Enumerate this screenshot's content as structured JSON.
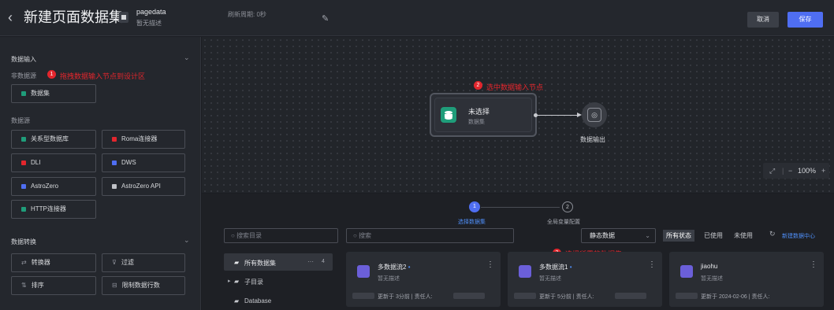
{
  "header": {
    "title": "新建页面数据集",
    "dataset_name": "pagedata",
    "dataset_desc": "暂无描述",
    "refresh": "刷新周期: 0秒",
    "cancel": "取消",
    "save": "保存"
  },
  "left": {
    "input_section": "数据输入",
    "non_source": "非数据源",
    "hint1": "拖拽数据输入节点到设计区",
    "dataset_btn": "数据集",
    "source_label": "数据源",
    "sources": [
      "关系型数据库",
      "Roma连接器",
      "DLI",
      "DWS",
      "AstroZero",
      "AstroZero API",
      "HTTP连接器"
    ],
    "transform_section": "数据转换",
    "transforms": [
      "转换器",
      "过滤",
      "排序",
      "限制数据行数"
    ]
  },
  "canvas": {
    "hint2": "选中数据输入节点",
    "node_title": "未选择",
    "node_sub": "数据集",
    "output_label": "数据输出",
    "zoom": "100%"
  },
  "steps": {
    "s1": "选择数据集",
    "s2": "全局变量配置"
  },
  "bottom": {
    "search_dir": "搜索目录",
    "search_main": "搜索",
    "select_value": "静态数据",
    "status": [
      "所有状态",
      "已使用",
      "未使用"
    ],
    "new_link": "新建数据中心",
    "tree": {
      "all": "所有数据集",
      "count": "4",
      "sub": "子目录",
      "db": "Database"
    },
    "hint3": "选择所需的数据集"
  },
  "cards": [
    {
      "name": "多数据流2",
      "desc": "暂无描述",
      "updated": "3分前",
      "owner": "责任人:"
    },
    {
      "name": "多数据流1",
      "desc": "暂无描述",
      "updated": "5分前",
      "owner": "责任人:"
    },
    {
      "name": "jiaohu",
      "desc": "暂无描述",
      "updated": "2024-02-06",
      "owner": "责任人:"
    }
  ]
}
